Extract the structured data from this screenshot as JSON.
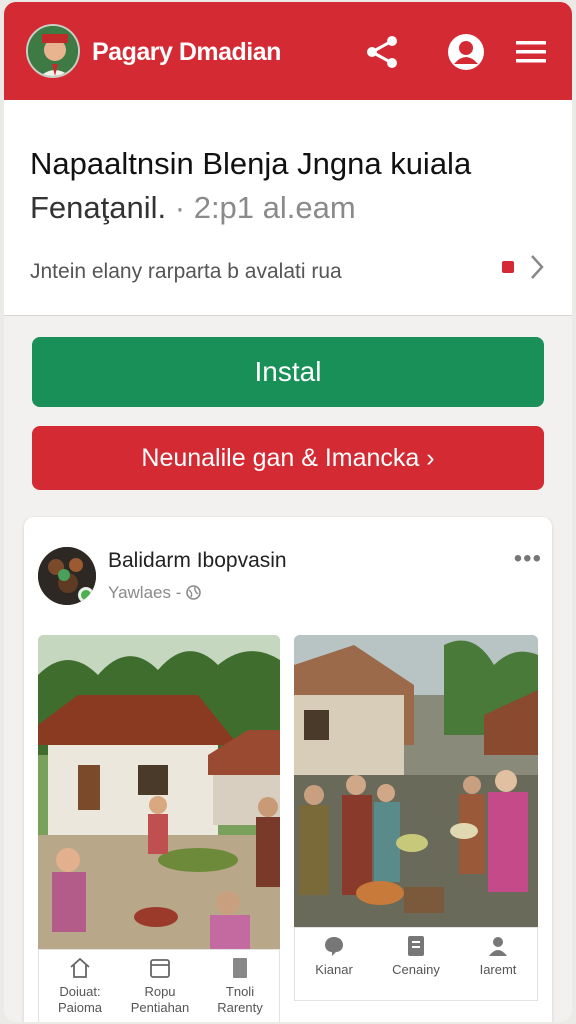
{
  "header": {
    "brand": "Pagary Dmadian"
  },
  "article": {
    "title_line1": "Napaaltnsin Blenja Jngna kuiala",
    "title_line2_prefix": "Fenaţanil.",
    "title_line2_muted": "· 2:p1 al.eam",
    "subtitle": "Jntein elany rarparta b avalati rua"
  },
  "buttons": {
    "install": "Instal",
    "secondary": "Neunalile gan & Imancka ›"
  },
  "post": {
    "author": "Balidarm Ibopvasin",
    "meta": "Yawlaes -",
    "more": "•••"
  },
  "nav_left": [
    {
      "label": "Doiuat:\nPaioma"
    },
    {
      "label": "Ropu\nPentiahan"
    },
    {
      "label": "Tnoli\nRarenty"
    }
  ],
  "nav_right": [
    {
      "label": "Kianar"
    },
    {
      "label": "Cenainy"
    },
    {
      "label": "Iaremt"
    }
  ],
  "colors": {
    "primary_red": "#d42a33",
    "install_green": "#189058"
  }
}
